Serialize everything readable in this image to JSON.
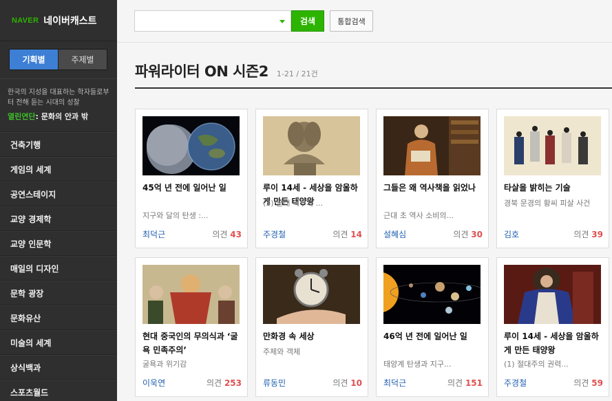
{
  "logo": {
    "brand": "NAVER",
    "service": "네이버캐스트"
  },
  "sidebar": {
    "tabs": [
      {
        "label": "기획별",
        "active": true
      },
      {
        "label": "주제별",
        "active": false
      }
    ],
    "description": "한국의 지성을 대표하는 학자들로부터 전해 듣는 시대의 성찰",
    "series_highlight": "열린연단",
    "series_rest": ": 문화의 안과 밖",
    "items": [
      {
        "label": "건축기행"
      },
      {
        "label": "게임의 세계"
      },
      {
        "label": "공연스테이지"
      },
      {
        "label": "교양 경제학"
      },
      {
        "label": "교양 인문학"
      },
      {
        "label": "매일의 디자인"
      },
      {
        "label": "문학 광장"
      },
      {
        "label": "문화유산"
      },
      {
        "label": "미술의 세계"
      },
      {
        "label": "상식백과"
      },
      {
        "label": "스포츠월드"
      }
    ]
  },
  "search": {
    "value": "",
    "button": "검색",
    "total": "통합검색"
  },
  "page": {
    "title": "파워라이터 ON 시즌2",
    "count": "1-21 / 21건"
  },
  "opinion_label": "의견",
  "cards": [
    {
      "title": "45억 년 전에 일어난 일",
      "subtitle": "지구와 달의 탄생 :...",
      "author": "최덕근",
      "opinions": "43",
      "thumb": "planets-collision-image"
    },
    {
      "title": "루이 14세 - 세상을 암울하게 만든 태양왕",
      "subtitle": "(3) 끝내 이루지 ...",
      "author": "주경철",
      "opinions": "14",
      "thumb": "bust-statue-image"
    },
    {
      "title": "그들은 왜 역사책을 읽었나",
      "subtitle": "근대 초 역사 소비의...",
      "author": "설혜심",
      "opinions": "30",
      "thumb": "reading-man-painting-image"
    },
    {
      "title": "타살을 밝히는 기술",
      "subtitle": "경북 문경의 황씨 피살 사건",
      "author": "김호",
      "opinions": "39",
      "thumb": "joseon-officials-painting-image"
    },
    {
      "title": "현대 중국인의 무의식과 ‘굴욕 민족주의’",
      "subtitle": "굴욕과 위기감",
      "author": "이욱연",
      "opinions": "253",
      "thumb": "caricature-image"
    },
    {
      "title": "만화경 속 세상",
      "subtitle": "주체와 객체",
      "author": "류동민",
      "opinions": "10",
      "thumb": "alarm-clock-hand-image"
    },
    {
      "title": "46억 년 전에 일어난 일",
      "subtitle": "태양계 탄생과 지구...",
      "author": "최덕근",
      "opinions": "151",
      "thumb": "solar-system-image"
    },
    {
      "title": "루이 14세 - 세상을 암울하게 만든 태양왕",
      "subtitle": "(1) 절대주의 권력...",
      "author": "주경철",
      "opinions": "59",
      "thumb": "louis-portrait-image"
    }
  ]
}
